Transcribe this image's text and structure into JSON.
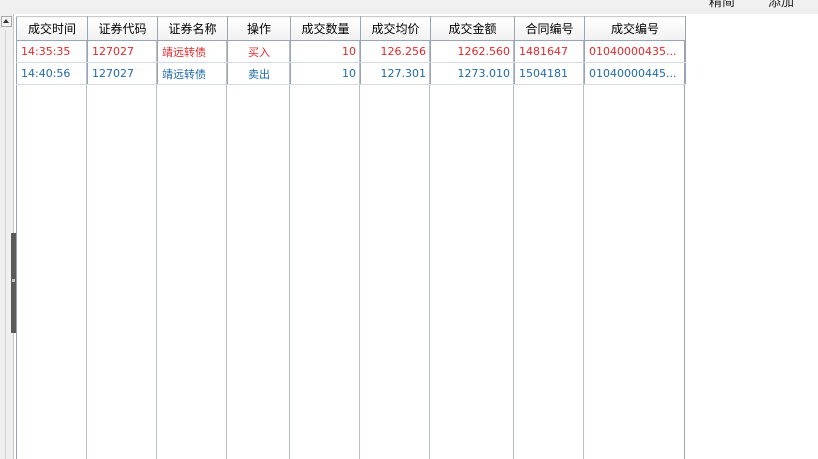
{
  "toolbar": {
    "button_1": "精简",
    "button_2": "添加"
  },
  "table": {
    "columns": [
      "成交时间",
      "证券代码",
      "证券名称",
      "操作",
      "成交数量",
      "成交均价",
      "成交金额",
      "合同编号",
      "成交编号"
    ],
    "rows": [
      {
        "side": "buy",
        "time": "14:35:35",
        "code": "127027",
        "name": "靖远转债",
        "action": "买入",
        "quantity": "10",
        "avg_price": "126.256",
        "amount": "1262.560",
        "contract_no": "1481647",
        "trade_no": "01040000435..."
      },
      {
        "side": "sell",
        "time": "14:40:56",
        "code": "127027",
        "name": "靖远转债",
        "action": "卖出",
        "quantity": "10",
        "avg_price": "127.301",
        "amount": "1273.010",
        "contract_no": "1504181",
        "trade_no": "01040000445..."
      }
    ]
  },
  "colors": {
    "buy": "#e0292b",
    "sell": "#1f6aa8"
  }
}
